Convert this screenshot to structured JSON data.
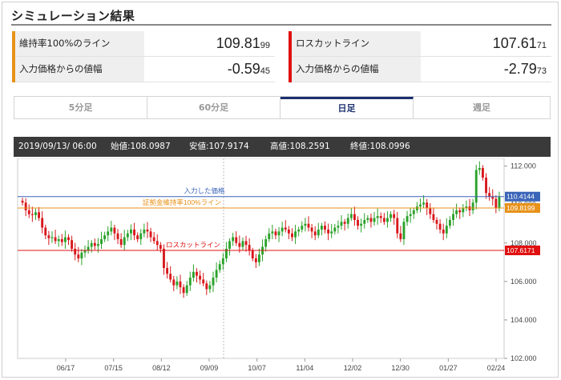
{
  "title": "シミュレーション結果",
  "left_box": {
    "accent": "#e8921a",
    "row1_label": "維持率100%のライン",
    "row1_value_main": "109.81",
    "row1_value_small": "99",
    "row2_label": "入力価格からの値幅",
    "row2_value_main": "-0.59",
    "row2_value_small": "45"
  },
  "right_box": {
    "accent": "#e01010",
    "row1_label": "ロスカットライン",
    "row1_value_main": "107.61",
    "row1_value_small": "71",
    "row2_label": "入力価格からの値幅",
    "row2_value_main": "-2.79",
    "row2_value_small": "73"
  },
  "tabs": [
    "5分足",
    "60分足",
    "日足",
    "週足"
  ],
  "active_tab": "日足",
  "info_bar": {
    "datetime": "2019/09/13/ 06:00",
    "open": "始値:108.0987",
    "low": "安値:107.9174",
    "high": "高値:108.2591",
    "close": "終値:108.0996"
  },
  "chart_data": {
    "type": "candlestick",
    "x_ticks": [
      "06/17",
      "07/15",
      "08/12",
      "09/09",
      "10/07",
      "11/04",
      "12/02",
      "12/30",
      "01/27",
      "02/24"
    ],
    "y_ticks": [
      "112.000",
      "110.000",
      "108.000",
      "106.000",
      "104.000",
      "102.000"
    ],
    "y_range": [
      102.0,
      112.4
    ],
    "closes": [
      110.1,
      109.7,
      109.5,
      109.45,
      109.6,
      109.3,
      108.8,
      108.4,
      108.25,
      108.3,
      108.1,
      108.2,
      108.05,
      108.3,
      108.15,
      107.7,
      107.4,
      107.2,
      107.5,
      107.6,
      107.8,
      108.0,
      107.85,
      107.95,
      108.2,
      108.4,
      108.6,
      108.8,
      108.5,
      108.2,
      107.9,
      108.3,
      108.5,
      108.7,
      108.4,
      108.2,
      108.5,
      108.7,
      108.6,
      108.3,
      108.1,
      107.9,
      107.7,
      106.7,
      106.4,
      106.1,
      105.8,
      106.0,
      105.7,
      105.4,
      105.8,
      106.2,
      106.5,
      106.3,
      106.1,
      105.9,
      105.6,
      105.8,
      106.2,
      106.6,
      106.9,
      107.2,
      107.7,
      108.1,
      108.3,
      108.0,
      107.8,
      108.1,
      107.9,
      107.6,
      107.2,
      107.0,
      107.4,
      107.8,
      108.2,
      108.5,
      108.6,
      108.4,
      108.6,
      108.8,
      108.7,
      108.5,
      108.3,
      108.6,
      108.7,
      108.9,
      109.0,
      108.8,
      108.6,
      108.4,
      108.7,
      108.9,
      108.7,
      108.5,
      108.6,
      108.8,
      108.9,
      109.1,
      109.0,
      109.3,
      109.5,
      109.2,
      108.9,
      109.0,
      109.2,
      109.3,
      109.1,
      109.3,
      109.4,
      109.3,
      109.1,
      109.3,
      109.5,
      109.3,
      108.5,
      108.2,
      109.1,
      109.4,
      109.5,
      109.7,
      109.9,
      110.0,
      110.1,
      109.8,
      109.5,
      109.2,
      109.0,
      108.7,
      108.5,
      108.9,
      109.2,
      109.5,
      109.7,
      109.6,
      109.8,
      109.9,
      109.7,
      110.1,
      111.8,
      111.9,
      111.4,
      110.6,
      110.4,
      110.3,
      109.8,
      110.4
    ],
    "horizontal_lines": [
      {
        "label": "入力した価格",
        "value": "110.4144",
        "color": "#3a64b8"
      },
      {
        "label": "証拠金維持率100%ライン",
        "value": "109.8199",
        "color": "#e8921a"
      },
      {
        "label": "ロスカットライン",
        "value": "107.6171",
        "color": "#e01010"
      }
    ],
    "up_color": "#2aa22a",
    "down_color": "#d8181c"
  }
}
